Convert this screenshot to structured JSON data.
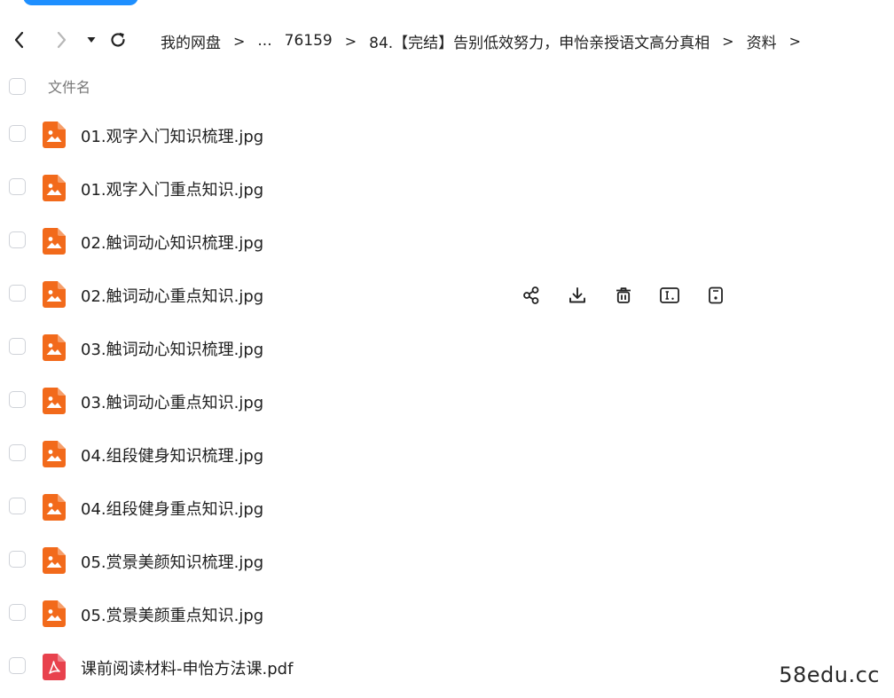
{
  "nav": {
    "back_icon": "chevron-left-icon",
    "forward_icon": "chevron-right-icon",
    "history_icon": "caret-down-icon",
    "refresh_icon": "refresh-icon"
  },
  "breadcrumb": {
    "items": [
      "我的网盘",
      "...",
      "76159",
      "84.【完结】告别低效努力，申怡亲授语文高分真相",
      "资料"
    ],
    "separator": ">"
  },
  "list_header": {
    "column_name": "文件名"
  },
  "files": [
    {
      "name": "01.观字入门知识梳理.jpg",
      "type": "image"
    },
    {
      "name": "01.观字入门重点知识.jpg",
      "type": "image"
    },
    {
      "name": "02.触词动心知识梳理.jpg",
      "type": "image"
    },
    {
      "name": "02.触词动心重点知识.jpg",
      "type": "image"
    },
    {
      "name": "03.触词动心知识梳理.jpg",
      "type": "image"
    },
    {
      "name": "03.触词动心重点知识.jpg",
      "type": "image"
    },
    {
      "name": "04.组段健身知识梳理.jpg",
      "type": "image"
    },
    {
      "name": "04.组段健身重点知识.jpg",
      "type": "image"
    },
    {
      "name": "05.赏景美颜知识梳理.jpg",
      "type": "image"
    },
    {
      "name": "05.赏景美颜重点知识.jpg",
      "type": "image"
    },
    {
      "name": "课前阅读材料-申怡方法课.pdf",
      "type": "pdf"
    }
  ],
  "hover_row_index": 3,
  "row_actions": [
    "share-icon",
    "download-icon",
    "delete-icon",
    "rename-icon",
    "more-icon"
  ],
  "watermark": "58edu.cc",
  "colors": {
    "accent": "#1e8fff",
    "image_icon": "#f26a1b",
    "pdf_icon": "#e8424d"
  }
}
